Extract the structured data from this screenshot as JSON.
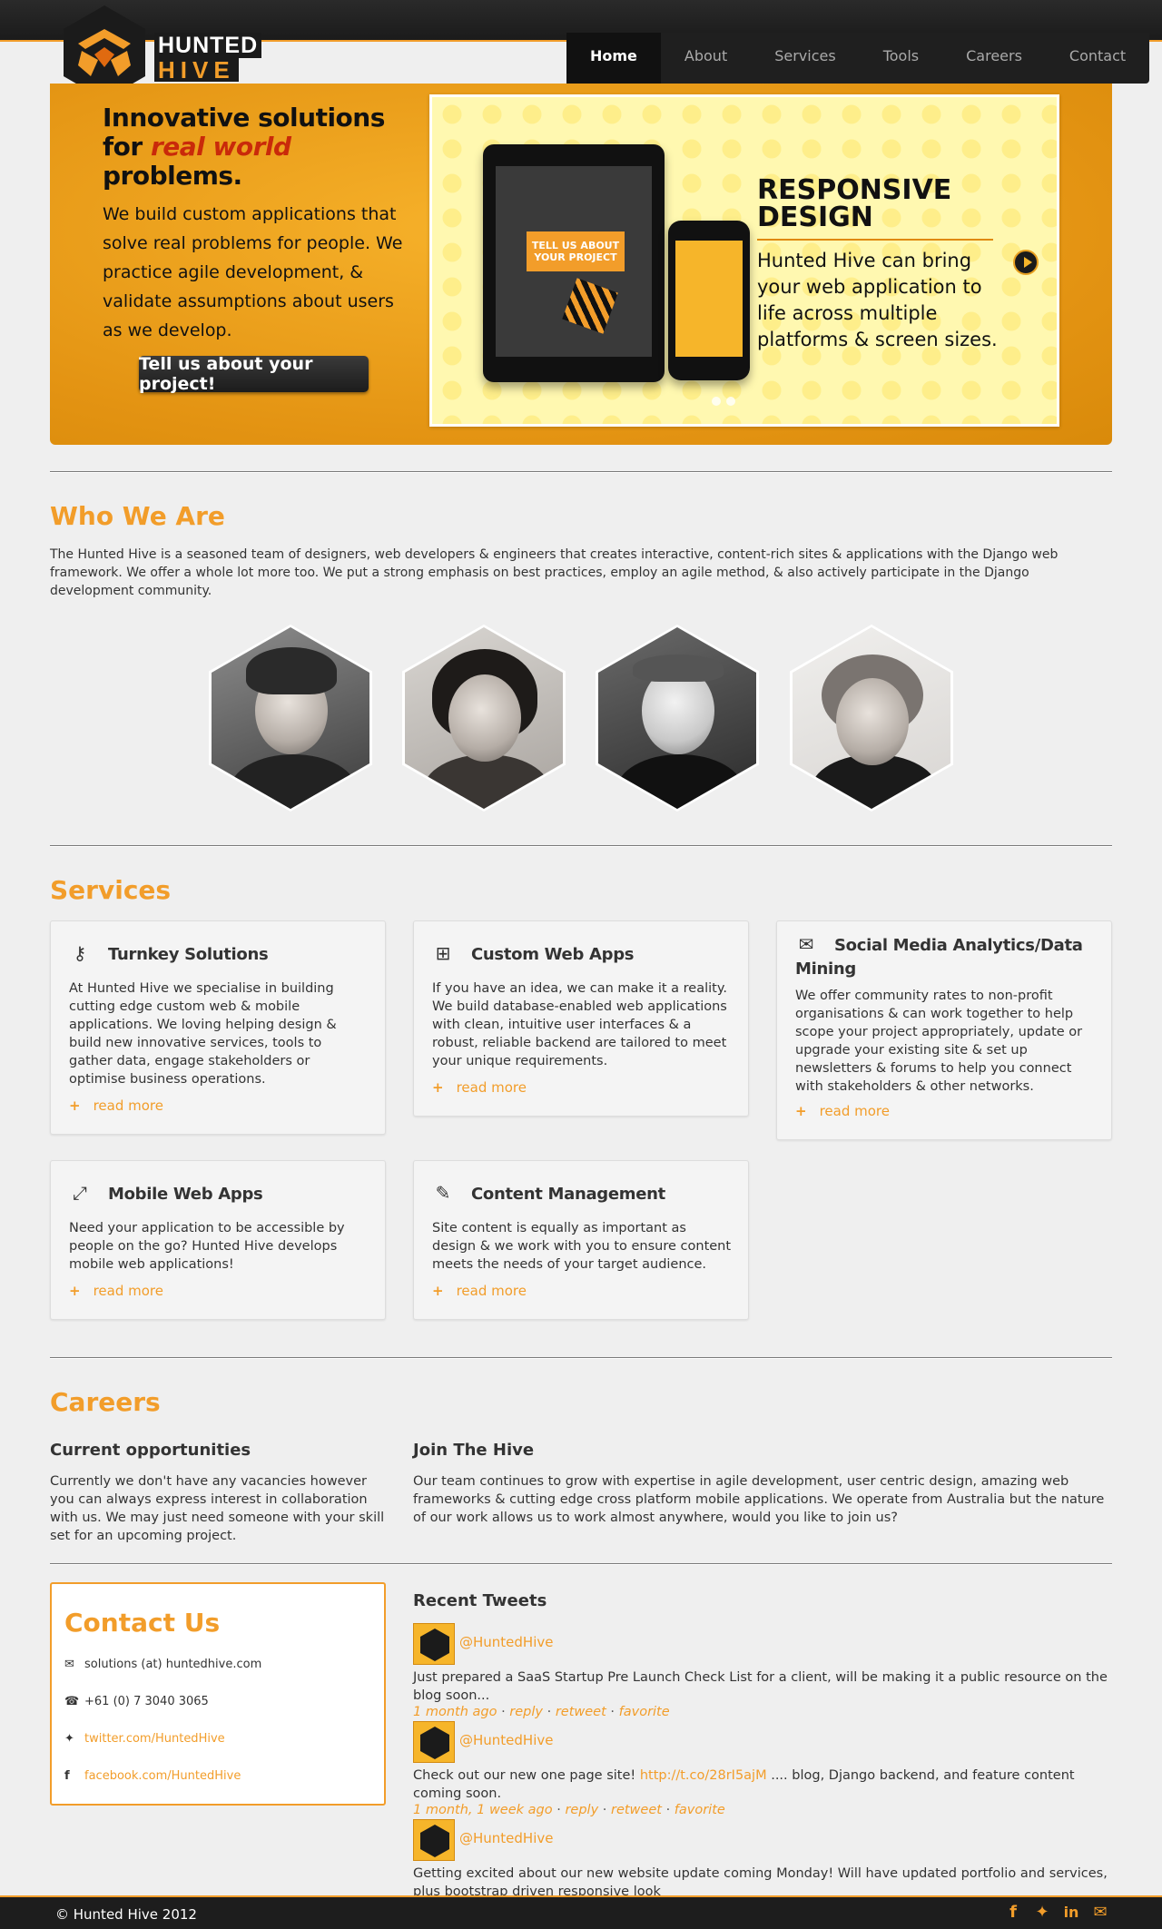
{
  "brand": {
    "line1": "HUNTED",
    "line2": "HIVE"
  },
  "nav": [
    "Home",
    "About",
    "Services",
    "Tools",
    "Careers",
    "Contact"
  ],
  "hero": {
    "title_a": "Innovative solutions for ",
    "title_em": "real world",
    "title_b": " problems.",
    "lead": "We build custom applications that solve real problems for people. We practice agile development, & validate assumptions about users as we develop.",
    "cta": "Tell us about your project!",
    "slide": {
      "bubble": "TELL US ABOUT YOUR PROJECT",
      "heading": "RESPONSIVE DESIGN",
      "text": "Hunted Hive can bring your web application to life across multiple platforms & screen sizes."
    }
  },
  "who": {
    "title": "Who We Are",
    "text": "The Hunted Hive is a seasoned team of designers, web developers & engineers that creates interactive, content-rich sites & applications with the Django web framework. We offer a whole lot more too. We put a strong emphasis on best practices, employ an agile method, & also actively participate in the Django development community."
  },
  "services": {
    "title": "Services",
    "more": "read more",
    "cards": [
      {
        "icon": "key-icon",
        "title": "Turnkey Solutions",
        "text": "At Hunted Hive we specialise in building cutting edge custom web & mobile applications. We loving helping design & build new innovative services, tools to gather data, engage stakeholders or optimise business operations."
      },
      {
        "icon": "sitemap-icon",
        "title": "Custom Web Apps",
        "text": "If you have an idea, we can make it a reality. We build database-enabled web applications with clean, intuitive user interfaces & a robust, reliable backend are tailored to meet your unique requirements."
      },
      {
        "icon": "comments-icon",
        "title": "Social Media Analytics/Data Mining",
        "text": "We offer community rates to non-profit organisations & can work together to help scope your project appropriately, update or upgrade your existing site & set up newsletters & forums to help you connect with stakeholders & other networks."
      },
      {
        "icon": "resize-icon",
        "title": "Mobile Web Apps",
        "text": "Need your application to be accessible by people on the go? Hunted Hive develops mobile web applications!"
      },
      {
        "icon": "pencil-icon",
        "title": "Content Management",
        "text": "Site content is equally as important as design & we work with you to ensure content meets the needs of your target audience."
      }
    ]
  },
  "careers": {
    "title": "Careers",
    "current_title": "Current opportunities",
    "current_text": "Currently we don't have any vacancies however you can always express interest in collaboration with us. We may just need someone with your skill set for an upcoming project.",
    "join_title": "Join The Hive",
    "join_text": "Our team continues to grow with expertise in agile development, user centric design, amazing web frameworks & cutting edge cross platform mobile applications. We operate from Australia but the nature of our work allows us to work almost anywhere, would you like to join us?"
  },
  "contact": {
    "title": "Contact Us",
    "email": "solutions (at) huntedhive.com",
    "phone": "+61 (0) 7 3040 3065",
    "twitter": "twitter.com/HuntedHive",
    "facebook": "facebook.com/HuntedHive"
  },
  "tweets": {
    "title": "Recent Tweets",
    "items": [
      {
        "user": "@HuntedHive",
        "text": "Just prepared a SaaS Startup Pre Launch Check List for a client, will be making it a public resource on the blog soon...",
        "link": "",
        "text_after": "",
        "time": "1 month ago",
        "reply": "reply",
        "retweet": "retweet",
        "favorite": "favorite"
      },
      {
        "user": "@HuntedHive",
        "text": "Check out our new one page site! ",
        "link": "http://t.co/28rI5ajM",
        "text_after": " .... blog, Django backend, and feature content coming soon.",
        "time": "1 month, 1 week ago",
        "reply": "reply",
        "retweet": "retweet",
        "favorite": "favorite"
      },
      {
        "user": "@HuntedHive",
        "text": "Getting excited about our new website update coming Monday! Will have updated portfolio and services, plus bootstrap driven responsive look",
        "link": "",
        "text_after": "",
        "time": "",
        "reply": "",
        "retweet": "",
        "favorite": ""
      }
    ]
  },
  "footer": {
    "copy": "© Hunted Hive 2012",
    "social": [
      "facebook-icon",
      "twitter-icon",
      "linkedin-icon",
      "mail-icon"
    ]
  },
  "colors": {
    "accent": "#f29d2a",
    "dark": "#1b1b1b",
    "hero": "#eea11d",
    "slide_bg": "#fff8b0"
  }
}
